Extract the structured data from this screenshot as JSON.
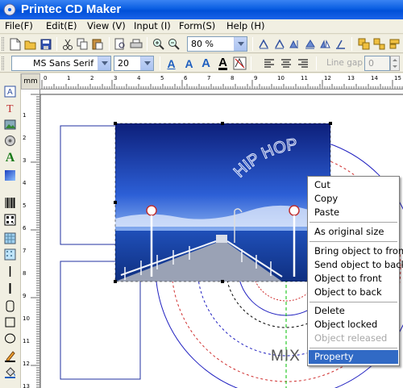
{
  "window": {
    "title": "Printec CD Maker"
  },
  "menubar": [
    "File(F)",
    "Edit(E)",
    "View (V)",
    "Input (I)",
    "Form(S)",
    "Help (H)"
  ],
  "toolbar1": {
    "zoom": "80 %"
  },
  "toolbar2": {
    "font_name": "MS Sans Serif",
    "font_size": "20",
    "line_gap_label": "Line gap :",
    "line_gap_value": "0"
  },
  "ruler": {
    "unit": "mm",
    "h_numbers": [
      "0",
      "1",
      "2",
      "3",
      "4",
      "5",
      "6",
      "7",
      "8",
      "9",
      "10",
      "11",
      "12",
      "13",
      "14",
      "15"
    ],
    "v_numbers": [
      "1",
      "2",
      "3",
      "4",
      "5",
      "6",
      "7",
      "8",
      "9",
      "10",
      "11",
      "12",
      "13"
    ]
  },
  "canvas": {
    "arc_text_top": "HIP HOP",
    "arc_text_bottom": "MIX"
  },
  "context_menu": {
    "items": [
      {
        "label": "Cut"
      },
      {
        "label": "Copy"
      },
      {
        "label": "Paste"
      },
      {
        "label": "As original size"
      },
      {
        "label": "Bring object to front"
      },
      {
        "label": "Send object to back"
      },
      {
        "label": "Object to front"
      },
      {
        "label": "Object to back"
      },
      {
        "label": "Delete"
      },
      {
        "label": "Object locked"
      },
      {
        "label": "Object released",
        "disabled": true
      },
      {
        "label": "Property",
        "selected": true
      }
    ]
  },
  "colors": {
    "title_bar": "#0a5ee2",
    "menu_highlight": "#316ac5",
    "guide_green": "#00c000",
    "guide_red": "#d03030",
    "circle_blue": "#2020c0"
  }
}
